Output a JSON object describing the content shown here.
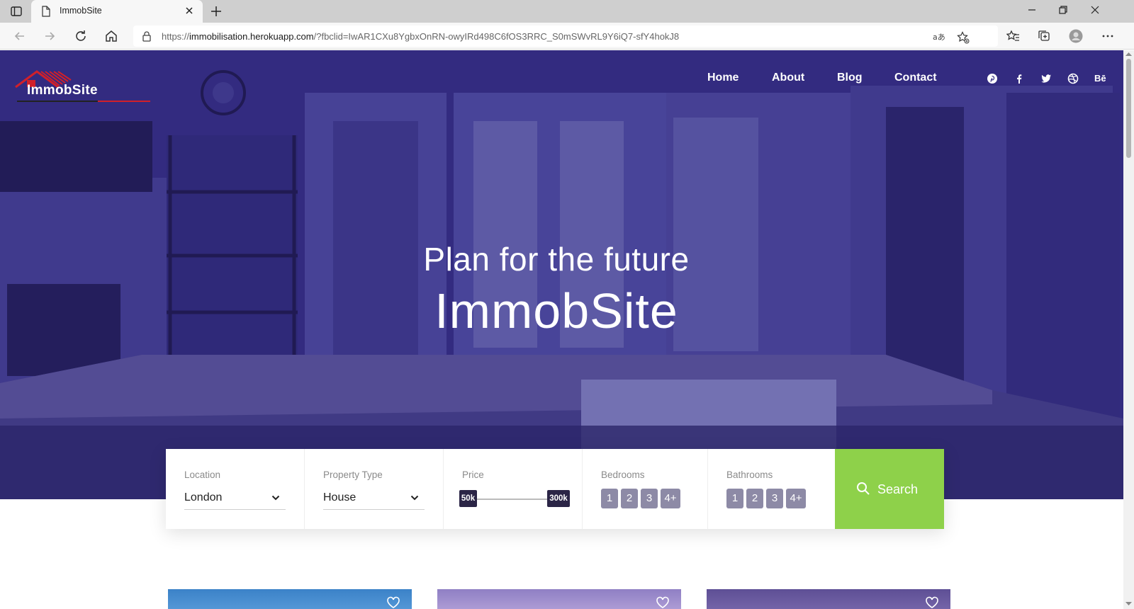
{
  "browser": {
    "tab_title": "ImmobSite",
    "url_scheme": "https://",
    "url_host": "immobilisation.herokuapp.com",
    "url_path": "/?fbclid=IwAR1CXu8YgbxOnRN-owyIRd498C6fOS3RRC_S0mSWvRL9Y6iQ7-sfY4hokJ8"
  },
  "site": {
    "logo_text": "ImmobSite",
    "nav": [
      "Home",
      "About",
      "Blog",
      "Contact"
    ],
    "social_icons": [
      "pinterest-icon",
      "facebook-icon",
      "twitter-icon",
      "dribbble-icon",
      "behance-icon"
    ],
    "behance_text": "Bē"
  },
  "hero": {
    "subtitle": "Plan for the future",
    "title": "ImmobSite"
  },
  "search": {
    "location": {
      "label": "Location",
      "value": "London"
    },
    "property_type": {
      "label": "Property Type",
      "value": "House"
    },
    "price": {
      "label": "Price",
      "min": "50k",
      "max": "300k"
    },
    "bedrooms": {
      "label": "Bedrooms",
      "options": [
        "1",
        "2",
        "3",
        "4+"
      ]
    },
    "bathrooms": {
      "label": "Bathrooms",
      "options": [
        "1",
        "2",
        "3",
        "4+"
      ]
    },
    "button_label": "Search"
  },
  "colors": {
    "hero_tint": "#3b3585",
    "search_button": "#8ed14a",
    "pill": "#8d8aa6",
    "slider_tag": "#2b2546"
  }
}
